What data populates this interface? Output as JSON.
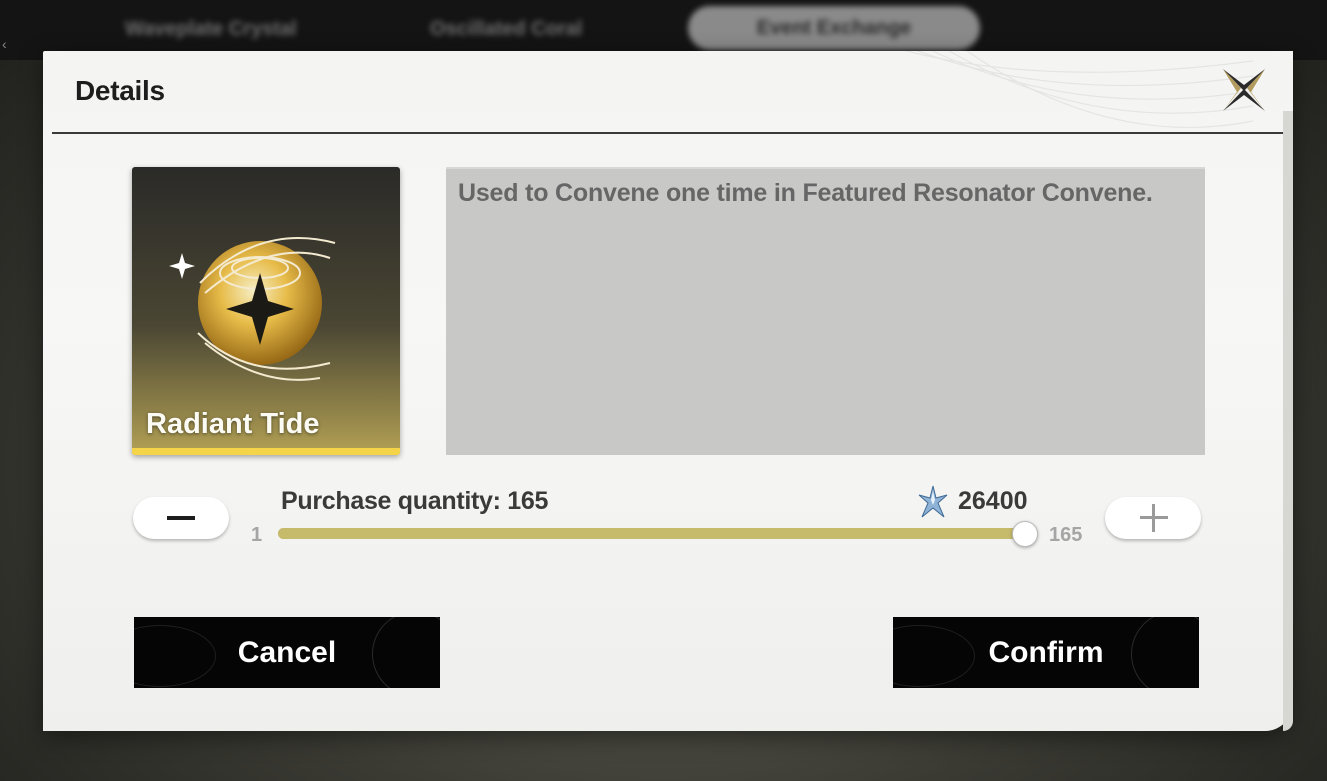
{
  "background": {
    "tabs": [
      "Waveplate Crystal",
      "Oscillated Coral",
      "Event Exchange"
    ]
  },
  "dialog": {
    "title": "Details",
    "close_icon": "close-x-icon"
  },
  "item": {
    "name": "Radiant Tide",
    "description": "Used to Convene one time in Featured Resonator Convene.",
    "rarity_color": "#f5d44a"
  },
  "purchase": {
    "quantity_label": "Purchase quantity: 165",
    "quantity": 165,
    "price": "26400",
    "currency_icon": "astrite-icon",
    "slider_min": "1",
    "slider_max": "165",
    "slider_fraction": 1.0
  },
  "actions": {
    "cancel_label": "Cancel",
    "confirm_label": "Confirm"
  }
}
